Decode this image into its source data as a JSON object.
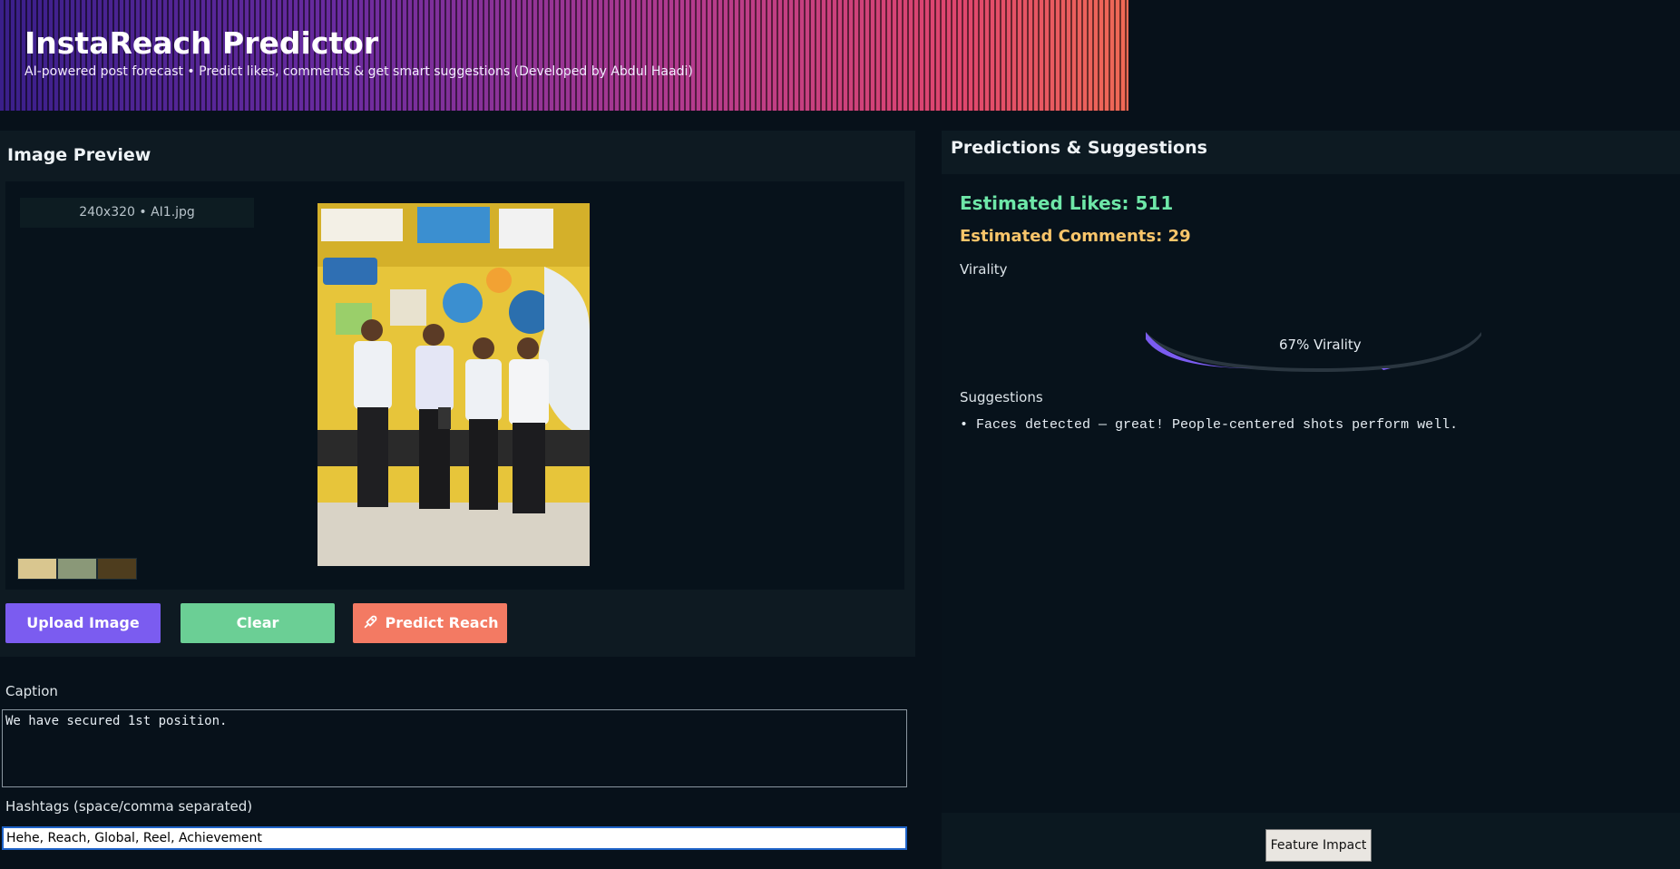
{
  "header": {
    "title": "InstaReach Predictor",
    "subtitle": "AI-powered post forecast • Predict likes, comments & get smart suggestions (Developed by Abdul Haadi)"
  },
  "preview": {
    "title": "Image Preview",
    "meta": "240x320 • AI1.jpg",
    "swatches": [
      "#d9c68f",
      "#8a9878",
      "#4e3d1e"
    ]
  },
  "buttons": {
    "upload": "Upload Image",
    "clear": "Clear",
    "predict": "Predict Reach"
  },
  "caption": {
    "label": "Caption",
    "value": "We have secured 1st position."
  },
  "hashtags": {
    "label": "Hashtags (space/comma separated)",
    "value": "Hehe, Reach, Global, Reel, Achievement"
  },
  "results": {
    "title": "Predictions & Suggestions",
    "likes": "Estimated Likes: 511",
    "comments": "Estimated Comments: 29",
    "virality_label": "Virality",
    "virality_percent": 67,
    "virality_text": "67%  Virality",
    "suggestions_label": "Suggestions",
    "suggestions": [
      "• Faces detected — great! People-centered shots perform well."
    ]
  },
  "footer": {
    "feature_button": "Feature Impact"
  },
  "colors": {
    "upload": "#7b5cf0",
    "clear": "#6bcf95",
    "predict": "#f37a63",
    "likes": "#6ee7a8",
    "comments": "#f9c56a",
    "gauge_fill": "#7b5cf0",
    "gauge_track": "#2a3640"
  }
}
